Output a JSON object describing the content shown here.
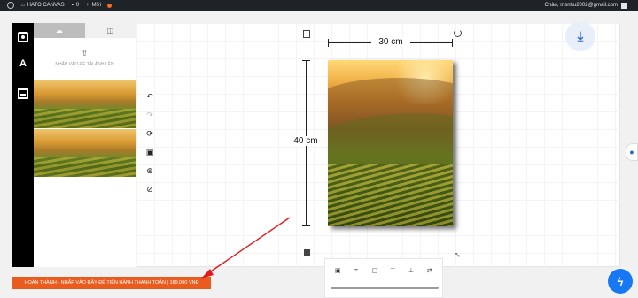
{
  "adminbar": {
    "site_title": "HATO CANVAS",
    "comments_count": "0",
    "new_label": "Mới",
    "greeting": "Chào, msnhu2002@gmail.com"
  },
  "panel": {
    "upload_hint": "NHẤP VÀO ĐỂ TẢI ẢNH LÊN"
  },
  "canvas": {
    "width_label": "30 cm",
    "height_label": "40 cm"
  },
  "finish_button_label": "HOÀN THÀNH - NHẤP VÀO ĐÂY ĐỂ TIẾN HÀNH THANH TOÁN | 189.000 VNĐ",
  "colors": {
    "accent_orange": "#ea5b1e",
    "arrow_red": "#e01a1a",
    "download_blue": "#2f67c7",
    "messenger_blue": "#1877f2"
  }
}
